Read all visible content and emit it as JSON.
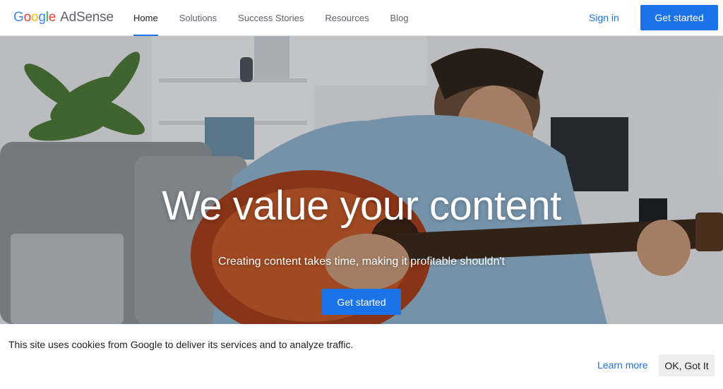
{
  "brand": {
    "logo_letters": [
      "G",
      "o",
      "o",
      "g",
      "l",
      "e"
    ],
    "logo_colors": [
      "#4285F4",
      "#EA4335",
      "#FBBC05",
      "#4285F4",
      "#34A853",
      "#EA4335"
    ],
    "product": "AdSense"
  },
  "nav": {
    "items": [
      {
        "label": "Home",
        "active": true
      },
      {
        "label": "Solutions",
        "active": false
      },
      {
        "label": "Success Stories",
        "active": false
      },
      {
        "label": "Resources",
        "active": false
      },
      {
        "label": "Blog",
        "active": false
      }
    ],
    "sign_in": "Sign in",
    "cta": "Get started"
  },
  "hero": {
    "title": "We value your content",
    "subtitle": "Creating content takes time, making it profitable shouldn't",
    "cta": "Get started"
  },
  "cookie_banner": {
    "text": "This site uses cookies from Google to deliver its services and to analyze traffic.",
    "learn_more": "Learn more",
    "ok": "OK, Got It"
  },
  "colors": {
    "accent": "#1a73e8",
    "text_primary": "#202124",
    "text_secondary": "#5f6368"
  }
}
